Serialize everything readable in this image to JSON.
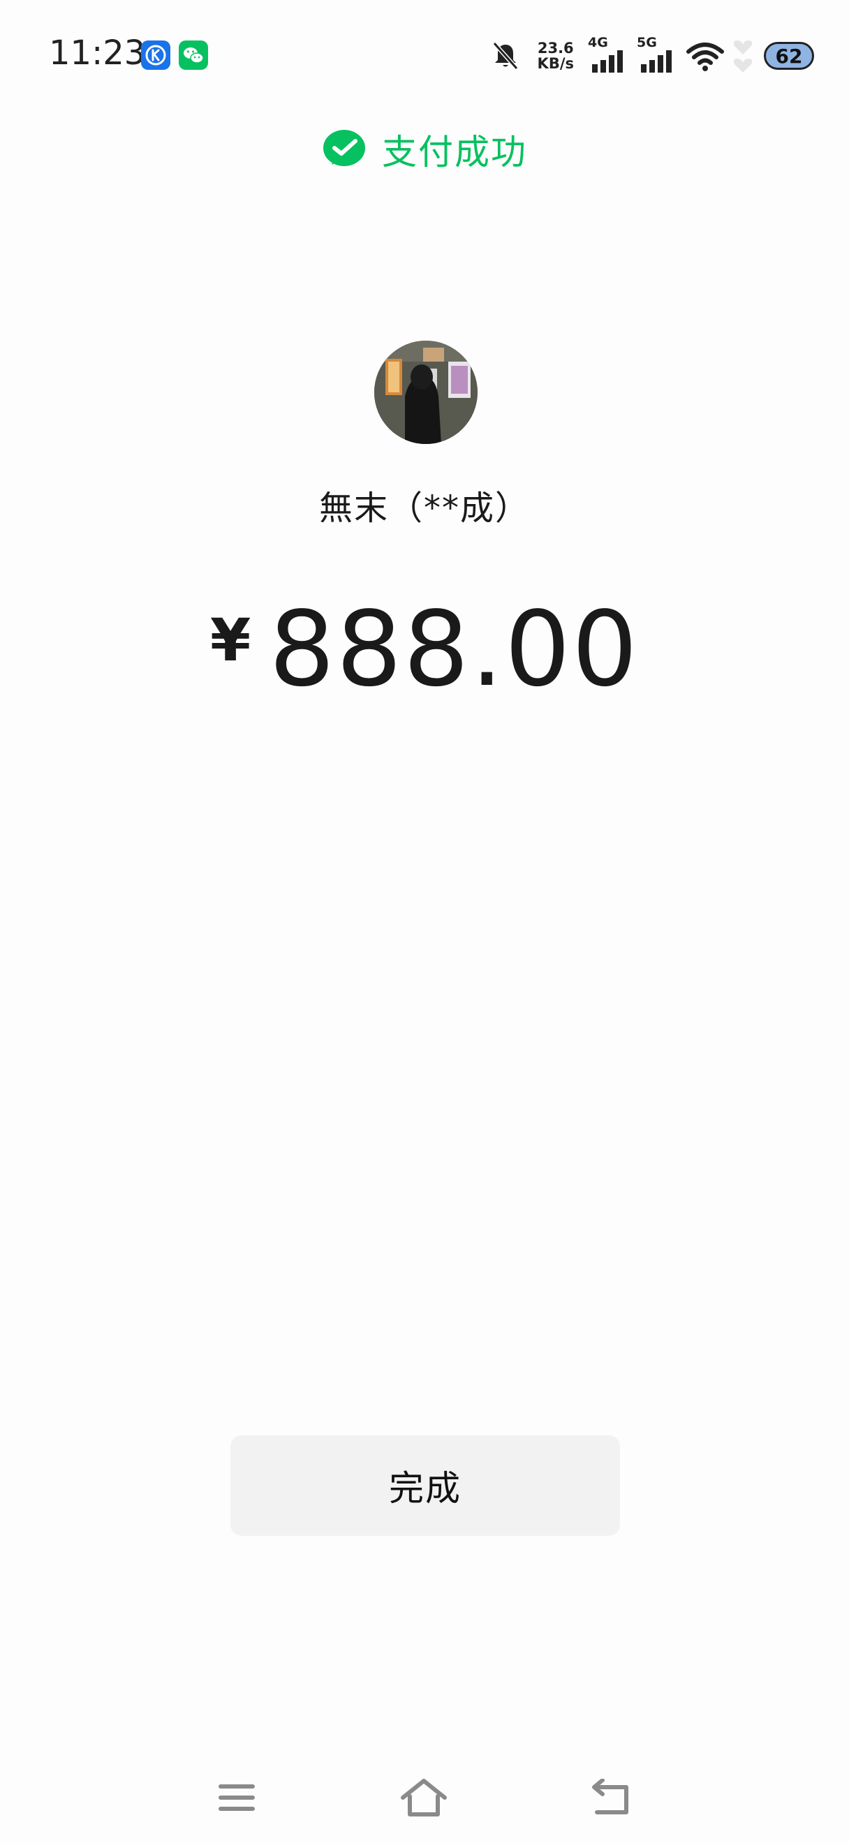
{
  "status_bar": {
    "time": "11:23",
    "net_speed_value": "23.6",
    "net_speed_unit": "KB/s",
    "signal_1_label": "4G",
    "signal_2_label": "5G",
    "battery": "62"
  },
  "header": {
    "title": "支付成功",
    "accent_color": "#07c160"
  },
  "payee": {
    "name": "無末（**成）"
  },
  "payment": {
    "currency_symbol": "¥",
    "amount": "888.00"
  },
  "actions": {
    "done_label": "完成"
  },
  "icons": {
    "status_app_1": "k-app-icon",
    "status_app_2": "wechat-icon",
    "header": "wechat-pay-success-icon",
    "nav_left": "menu-icon",
    "nav_center": "home-icon",
    "nav_right": "back-icon"
  }
}
